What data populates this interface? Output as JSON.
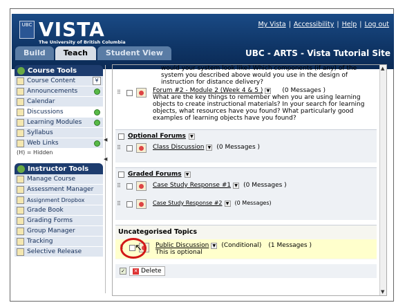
{
  "header": {
    "logo_mark": "UBC",
    "logo": "VISTA",
    "logo_sub": "The University of British Columbia",
    "links": [
      "My Vista",
      "Accessibility",
      "Help",
      "Log out"
    ],
    "site_title": "UBC - ARTS - Vista Tutorial Site",
    "tabs": [
      "Build",
      "Teach",
      "Student View"
    ],
    "active_tab": "Teach"
  },
  "sidebar": {
    "course_tools_title": "Course Tools",
    "course_items": [
      {
        "label": "Course Content",
        "icon": "book-icon",
        "has_toggle": true
      },
      {
        "label": "Announcements",
        "icon": "megaphone-icon",
        "has_add": true
      },
      {
        "label": "Calendar",
        "icon": "calendar-icon"
      },
      {
        "label": "Discussions",
        "icon": "discussion-icon",
        "has_add": true,
        "active": true
      },
      {
        "label": "Learning Modules",
        "icon": "modules-icon",
        "has_add": true
      },
      {
        "label": "Syllabus",
        "icon": "syllabus-icon"
      },
      {
        "label": "Web Links",
        "icon": "globe-icon",
        "has_add": true
      }
    ],
    "hidden_note": "(H) = Hidden",
    "instructor_tools_title": "Instructor Tools",
    "instructor_items": [
      {
        "label": "Manage Course",
        "icon": "manage-icon"
      },
      {
        "label": "Assessment Manager",
        "icon": "assessment-icon"
      },
      {
        "label": "Assignment Dropbox",
        "icon": "dropbox-icon"
      },
      {
        "label": "Grade Book",
        "icon": "gradebook-icon"
      },
      {
        "label": "Grading Forms",
        "icon": "grading-forms-icon"
      },
      {
        "label": "Group Manager",
        "icon": "group-icon"
      },
      {
        "label": "Tracking",
        "icon": "tracking-icon"
      },
      {
        "label": "Selective Release",
        "icon": "release-icon"
      }
    ]
  },
  "content": {
    "top_desc": "would your system look like? Which components (if any) of the system you described above would you use in the design of instruction for distance delivery?",
    "forum2": {
      "title": "Forum #2 - Module 2 (Week 4 & 5 )",
      "messages": "(0 Messages )",
      "desc": "What are the key things to remember when you are using learning objects to create instructional materials? In your search for learning objects, what resources have you found? What particularly good examples of learning objects have you found?"
    },
    "optional": {
      "title": "Optional Forums",
      "forum": "Class Discussion",
      "messages": "(0 Messages )"
    },
    "graded": {
      "title": "Graded Forums",
      "forums": [
        {
          "title": "Case Study Response #1",
          "messages": "(0 Messages )"
        },
        {
          "title": "Case Study Response #2",
          "messages": "(0 Messages)"
        }
      ]
    },
    "uncategorised": {
      "title": "Uncategorised Topics",
      "forum": "Public Discussion",
      "condition": "(Conditional)",
      "messages": "(1 Messages )",
      "note": "This is optional"
    },
    "delete_label": "Delete"
  }
}
